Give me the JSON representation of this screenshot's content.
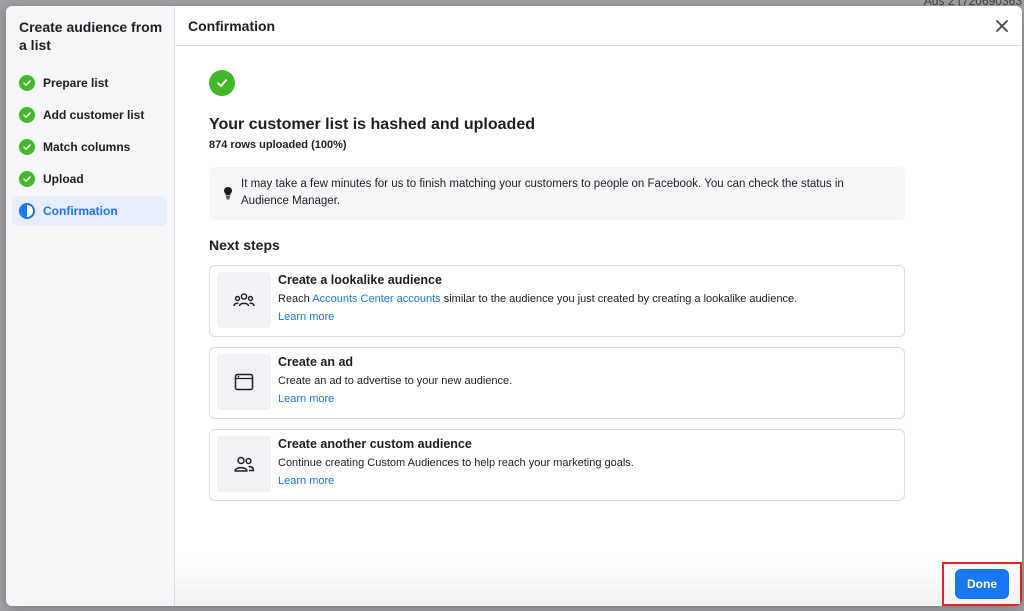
{
  "background": {
    "account_label": "Ads 2 (720690363"
  },
  "sidebar": {
    "title": "Create audience from a list",
    "steps": [
      {
        "label": "Prepare list",
        "state": "complete"
      },
      {
        "label": "Add customer list",
        "state": "complete"
      },
      {
        "label": "Match columns",
        "state": "complete"
      },
      {
        "label": "Upload",
        "state": "complete"
      },
      {
        "label": "Confirmation",
        "state": "active"
      }
    ]
  },
  "header": {
    "title": "Confirmation",
    "close_icon": "close-icon"
  },
  "main": {
    "headline": "Your customer list is hashed and uploaded",
    "subline": "874 rows uploaded (100%)",
    "info": "It may take a few minutes for us to finish matching your customers to people on Facebook. You can check the status in Audience Manager.",
    "next_steps_title": "Next steps",
    "cards": [
      {
        "title": "Create a lookalike audience",
        "desc_before": "Reach ",
        "desc_link": "Accounts Center accounts",
        "desc_after": " similar to the audience you just created by creating a lookalike audience.",
        "link": "Learn more",
        "icon": "group-icon"
      },
      {
        "title": "Create an ad",
        "desc": "Create an ad to advertise to your new audience.",
        "link": "Learn more",
        "icon": "ad-window-icon"
      },
      {
        "title": "Create another custom audience",
        "desc": "Continue creating Custom Audiences to help reach your marketing goals.",
        "link": "Learn more",
        "icon": "people-icon"
      }
    ]
  },
  "footer": {
    "done_label": "Done"
  },
  "colors": {
    "accent": "#1877f2",
    "success": "#42b72a",
    "highlight_border": "#e02424"
  }
}
